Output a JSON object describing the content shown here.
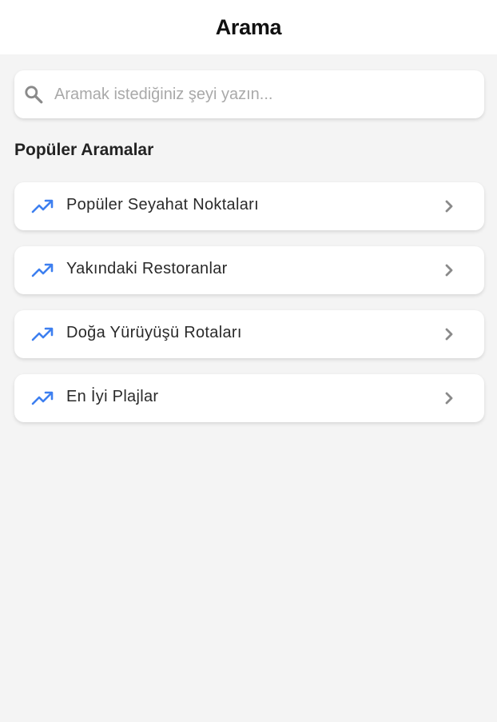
{
  "app_bar": {
    "title": "Arama"
  },
  "search": {
    "placeholder": "Aramak istediğiniz şeyi yazın...",
    "value": "",
    "icon": "search-icon"
  },
  "popular": {
    "title": "Popüler Aramalar",
    "items": [
      {
        "label": "Popüler Seyahat Noktaları",
        "icon": "trending-up-icon"
      },
      {
        "label": "Yakındaki Restoranlar",
        "icon": "trending-up-icon"
      },
      {
        "label": "Doğa Yürüyüşü Rotaları",
        "icon": "trending-up-icon"
      },
      {
        "label": "En İyi Plajlar",
        "icon": "trending-up-icon"
      }
    ]
  },
  "colors": {
    "background": "#f4f4f4",
    "surface": "#ffffff",
    "accent": "#3d7ff0",
    "icon_gray": "#8a8a8a"
  }
}
